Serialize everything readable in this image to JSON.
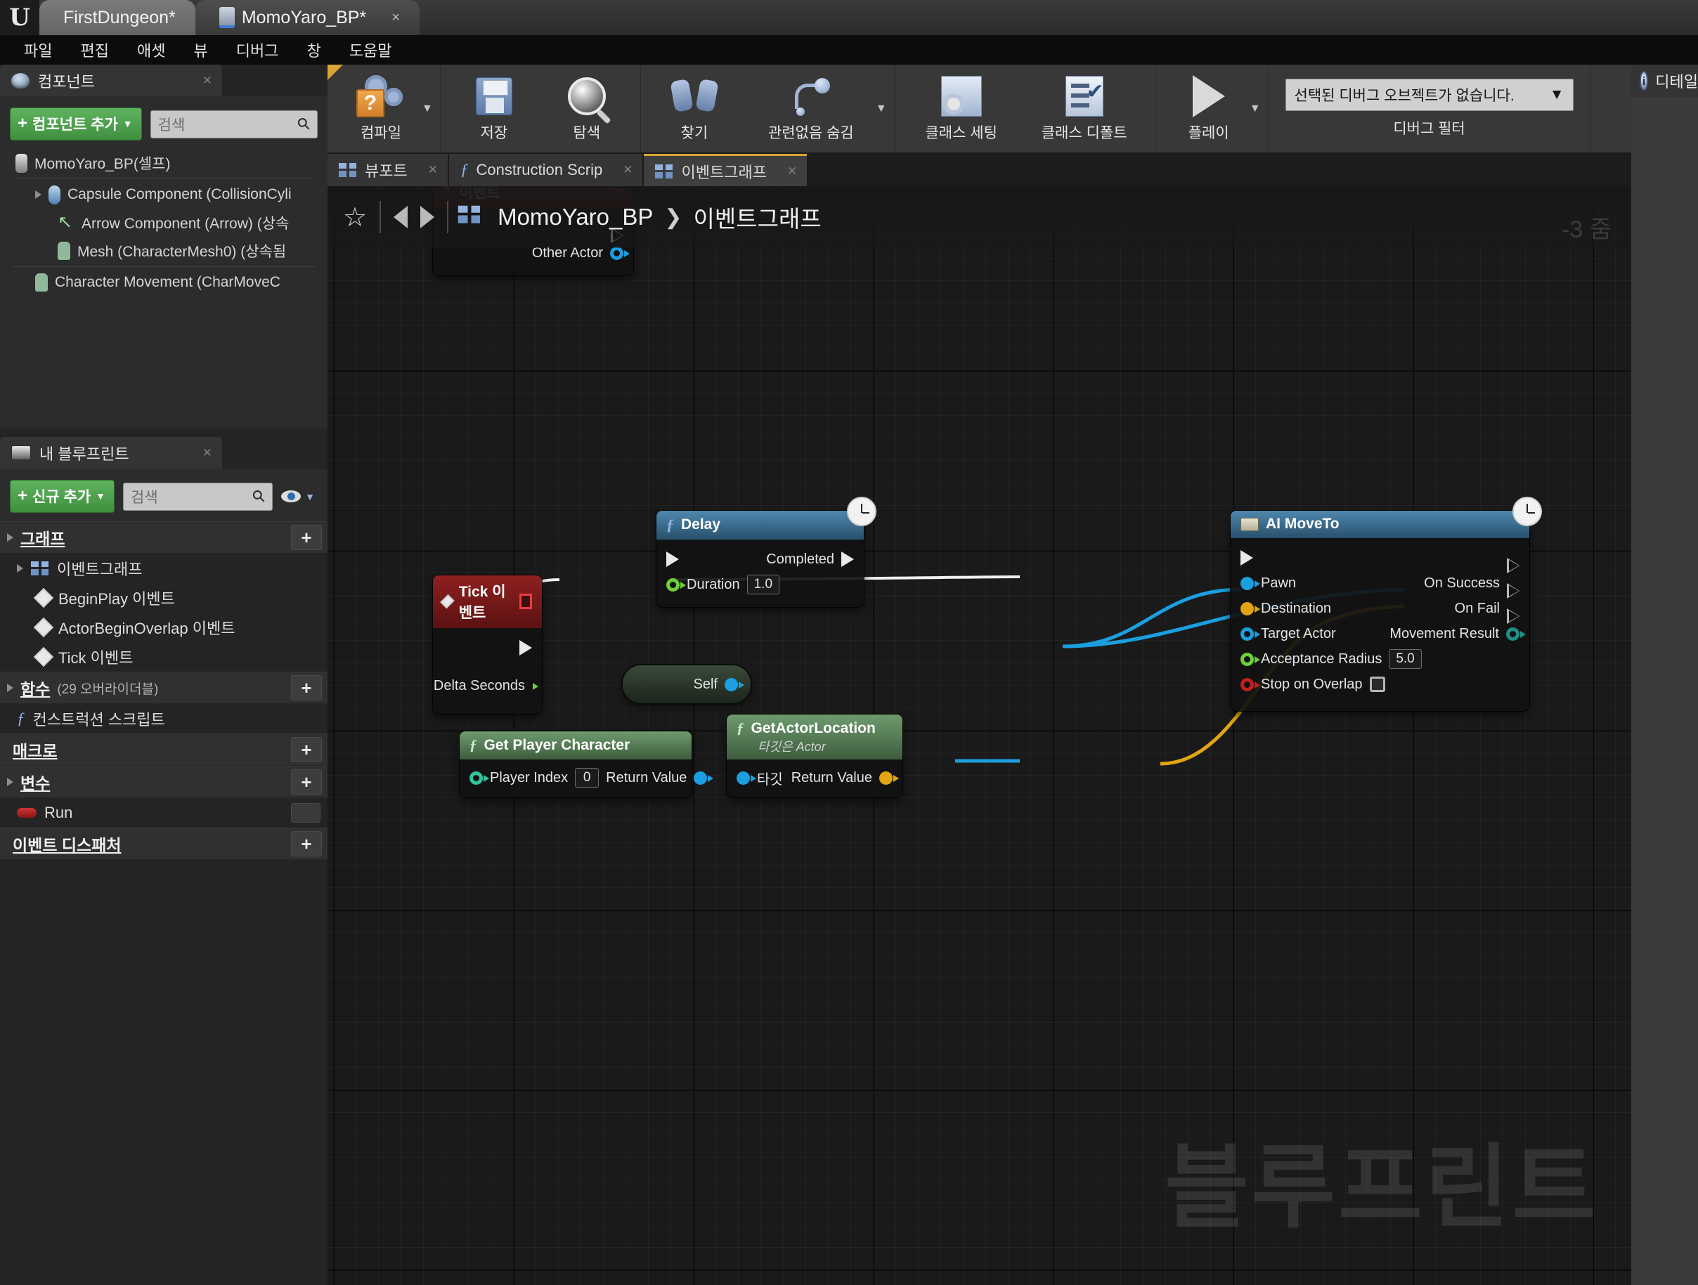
{
  "window": {
    "logo": "unreal-engine-logo",
    "tabs": [
      {
        "label": "FirstDungeon*",
        "active": false
      },
      {
        "label": "MomoYaro_BP*",
        "active": true
      }
    ],
    "close_glyph": "×"
  },
  "menubar": {
    "items": [
      "파일",
      "편집",
      "애셋",
      "뷰",
      "디버그",
      "창",
      "도움말"
    ]
  },
  "toolbar": {
    "groups": [
      {
        "buttons": [
          {
            "label": "컴파일",
            "icon": "compile-icon",
            "dropdown": true
          }
        ]
      },
      {
        "buttons": [
          {
            "label": "저장",
            "icon": "save-icon",
            "dropdown": false
          },
          {
            "label": "탐색",
            "icon": "browse-icon",
            "dropdown": false
          }
        ]
      },
      {
        "buttons": [
          {
            "label": "찾기",
            "icon": "find-binoculars-icon",
            "dropdown": false
          },
          {
            "label": "관련없음 숨김",
            "icon": "hide-unrelated-icon",
            "dropdown": true
          }
        ]
      },
      {
        "buttons": [
          {
            "label": "클래스 세팅",
            "icon": "class-settings-icon",
            "dropdown": false
          },
          {
            "label": "클래스 디폴트",
            "icon": "class-defaults-icon",
            "dropdown": false
          }
        ]
      },
      {
        "buttons": [
          {
            "label": "플레이",
            "icon": "play-icon",
            "dropdown": true
          }
        ]
      }
    ],
    "debug": {
      "selected_object": "선택된 디버그 오브젝트가 없습니다.",
      "caret": "▼",
      "filter_label": "디버그 필터"
    }
  },
  "components_panel": {
    "tab_title": "컴포넌트",
    "add_button": "컴포넌트 추가",
    "search_placeholder": "검색",
    "tree": [
      {
        "label": "MomoYaro_BP(셀프)",
        "icon": "self-capsule-icon",
        "indent": 0,
        "expander": false
      },
      {
        "label": "Capsule Component (CollisionCyli",
        "icon": "capsule-icon",
        "indent": 1,
        "expander": true
      },
      {
        "label": "Arrow Component (Arrow) (상속",
        "icon": "arrow-icon",
        "indent": 2,
        "expander": false
      },
      {
        "label": "Mesh (CharacterMesh0) (상속됨",
        "icon": "mesh-icon",
        "indent": 2,
        "expander": false
      },
      {
        "label": "Character Movement (CharMoveC",
        "icon": "char-movement-icon",
        "indent": 1,
        "expander": false
      }
    ]
  },
  "myblueprint_panel": {
    "tab_title": "내 블루프린트",
    "add_button": "신규 추가",
    "search_placeholder": "검색",
    "sections": [
      {
        "title": "그래프",
        "subtitle": "",
        "add": "+",
        "items": [
          {
            "label": "이벤트그래프",
            "icon": "event-graph-icon",
            "indent": 0
          },
          {
            "label": "BeginPlay 이벤트",
            "icon": "event-diamond-icon",
            "indent": 1
          },
          {
            "label": "ActorBeginOverlap 이벤트",
            "icon": "event-diamond-icon",
            "indent": 1
          },
          {
            "label": "Tick 이벤트",
            "icon": "event-diamond-icon",
            "indent": 1
          }
        ]
      },
      {
        "title": "함수",
        "subtitle": "(29 오버라이더블)",
        "add": "+",
        "items": [
          {
            "label": "컨스트럭션 스크립트",
            "icon": "function-icon",
            "indent": 0
          }
        ]
      },
      {
        "title": "매크로",
        "subtitle": "",
        "add": "+",
        "items": []
      },
      {
        "title": "변수",
        "subtitle": "",
        "add": "+",
        "items": [
          {
            "label": "Run",
            "icon": "bool-variable-icon",
            "indent": 0,
            "trailing": "visibility-toggle"
          }
        ]
      },
      {
        "title": "이벤트 디스패처",
        "subtitle": "",
        "add": "+",
        "items": []
      }
    ]
  },
  "graph": {
    "tabs": [
      {
        "label": "뷰포트",
        "icon": "viewport-icon",
        "active": false
      },
      {
        "label": "Construction Scrip",
        "icon": "function-icon",
        "active": false
      },
      {
        "label": "이벤트그래프",
        "icon": "event-graph-icon",
        "active": true
      }
    ],
    "breadcrumb": {
      "root": "MomoYaro_BP",
      "separator": "❯",
      "leaf": "이벤트그래프"
    },
    "zoom_label": "-3 줌",
    "watermark": "블루프린트",
    "nodes": [
      {
        "id": "actor-begin-overlap",
        "title": "ActorBeginOverlap 이벤트",
        "header_color": "red",
        "occluded": true,
        "outputs": [
          {
            "label": "",
            "type": "exec"
          },
          {
            "label": "Other Actor",
            "type": "object"
          }
        ]
      },
      {
        "id": "tick-event",
        "title": "Tick 이벤트",
        "header_color": "red",
        "icon": "event-diamond-icon",
        "outputs": [
          {
            "label": "",
            "type": "exec"
          },
          {
            "label": "Delta Seconds",
            "type": "float"
          }
        ]
      },
      {
        "id": "delay",
        "title": "Delay",
        "header_color": "blue",
        "icon": "function-icon",
        "badge": "latent-clock-icon",
        "inputs": [
          {
            "label": "",
            "type": "exec"
          },
          {
            "label": "Duration",
            "type": "float",
            "value": "1.0"
          }
        ],
        "outputs": [
          {
            "label": "Completed",
            "type": "exec"
          }
        ]
      },
      {
        "id": "self-node",
        "title": "Self",
        "outputs": [
          {
            "label": "Self",
            "type": "object"
          }
        ]
      },
      {
        "id": "get-player-character",
        "title": "Get Player Character",
        "header_color": "green",
        "icon": "function-icon",
        "inputs": [
          {
            "label": "Player Index",
            "type": "int",
            "value": "0"
          }
        ],
        "outputs": [
          {
            "label": "Return Value",
            "type": "object"
          }
        ]
      },
      {
        "id": "get-actor-location",
        "title": "GetActorLocation",
        "subtitle": "타깃은 Actor",
        "header_color": "green",
        "icon": "function-icon",
        "inputs": [
          {
            "label": "타깃",
            "type": "object"
          }
        ],
        "outputs": [
          {
            "label": "Return Value",
            "type": "vector"
          }
        ]
      },
      {
        "id": "ai-moveto",
        "title": "AI MoveTo",
        "header_color": "blue",
        "icon": "aimoveto-icon",
        "badge": "latent-clock-icon",
        "inputs": [
          {
            "label": "",
            "type": "exec"
          },
          {
            "label": "Pawn",
            "type": "object"
          },
          {
            "label": "Destination",
            "type": "vector"
          },
          {
            "label": "Target Actor",
            "type": "object-hollow"
          },
          {
            "label": "Acceptance Radius",
            "type": "float",
            "value": "5.0"
          },
          {
            "label": "Stop on Overlap",
            "type": "bool",
            "value": "unchecked"
          }
        ],
        "outputs": [
          {
            "label": "",
            "type": "exec-hollow"
          },
          {
            "label": "On Success",
            "type": "exec-hollow"
          },
          {
            "label": "On Fail",
            "type": "exec-hollow"
          },
          {
            "label": "Movement Result",
            "type": "enum-hollow"
          }
        ]
      }
    ],
    "wire_colors": {
      "exec": "#f0f0f0",
      "object": "#1b9fe0",
      "vector": "#e0a513",
      "float": "#6ecf3a"
    }
  },
  "details_panel": {
    "tab_title": "디테일",
    "icon": "info-search-icon"
  }
}
